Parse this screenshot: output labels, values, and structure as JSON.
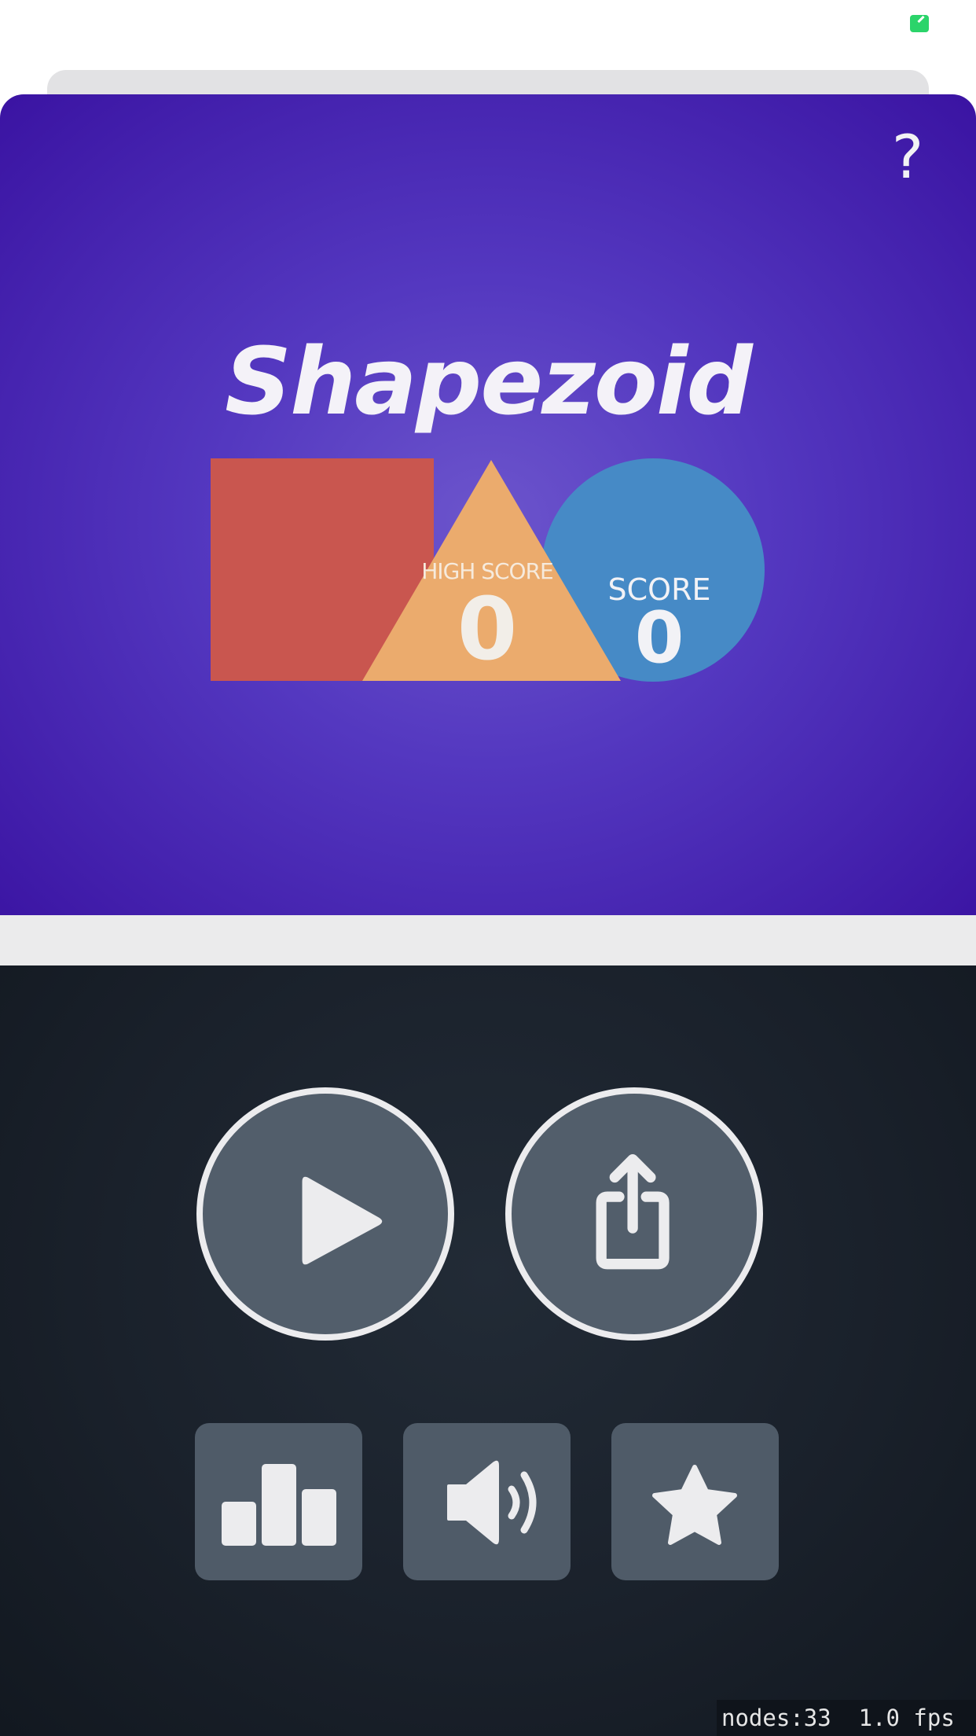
{
  "status": {
    "indicator_color": "#2bd46a"
  },
  "header": {
    "help_label": "?",
    "title": "Shapezoid"
  },
  "scores": {
    "high_score_label": "HIGH SCORE",
    "high_score_value": "0",
    "score_label": "SCORE",
    "score_value": "0"
  },
  "logo": {
    "square_color": "#c9564f",
    "triangle_color": "#ebab6d",
    "circle_color": "#468ac6"
  },
  "controls": {
    "play_icon": "play-icon",
    "share_icon": "share-icon",
    "leaderboard_icon": "leaderboard-icon",
    "sound_icon": "speaker-icon",
    "rate_icon": "star-icon"
  },
  "debug": {
    "stats": "nodes:33  1.0 fps"
  },
  "colors": {
    "game_bg": "#5438c0",
    "controls_bg": "#1a212b",
    "button_fill": "#525e6b",
    "button_outline": "#ececee"
  }
}
